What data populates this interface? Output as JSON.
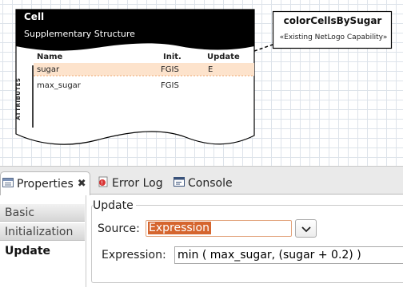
{
  "diagram": {
    "cell": {
      "title": "Cell",
      "subtitle": "Supplementary Structure",
      "columns": [
        "Name",
        "Init.",
        "Update"
      ],
      "rows": [
        {
          "name": "sugar",
          "init": "FGIS",
          "update": "E"
        },
        {
          "name": "max_sugar",
          "init": "FGIS",
          "update": ""
        }
      ],
      "attributes_label": "ATTRIBUTES"
    },
    "capability": {
      "title": "colorCellsBySugar",
      "subtitle": "«Existing NetLogo Capability»"
    }
  },
  "tabs": [
    {
      "label": "Properties",
      "icon": "properties-icon",
      "active": true
    },
    {
      "label": "Error Log",
      "icon": "error-log-icon",
      "active": false
    },
    {
      "label": "Console",
      "icon": "console-icon",
      "active": false
    }
  ],
  "categories": [
    "Basic",
    "Initialization",
    "Update"
  ],
  "selected_category": "Update",
  "section": {
    "title": "Update",
    "source_label": "Source:",
    "source_value": "Expression",
    "expression_label": "Expression:",
    "expression_value": "min ( max_sugar, (sugar + 0.2) )"
  },
  "colors": {
    "selected_row": "#fde3cc",
    "selection": "#d5652e",
    "header_black": "#000000"
  }
}
